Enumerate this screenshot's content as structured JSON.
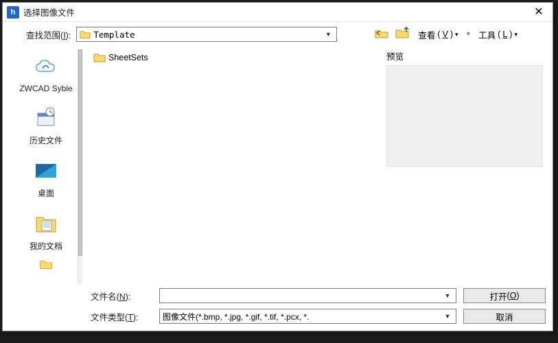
{
  "window": {
    "title": "选择图像文件"
  },
  "toolbar": {
    "lookin_label": "查找范围",
    "lookin_mnemonic": "I",
    "lookin_value": "Template",
    "view_label": "查看",
    "view_mnemonic": "V",
    "tools_label": "工具",
    "tools_mnemonic": "L"
  },
  "sidebar": {
    "items": [
      {
        "label": "ZWCAD Syble"
      },
      {
        "label": "历史文件"
      },
      {
        "label": "桌面"
      },
      {
        "label": "我的文档"
      }
    ]
  },
  "files": {
    "items": [
      {
        "name": "SheetSets",
        "type": "folder"
      }
    ]
  },
  "preview": {
    "label": "预览"
  },
  "bottom": {
    "filename_label": "文件名",
    "filename_mnemonic": "N",
    "filename_value": "",
    "filetype_label": "文件类型",
    "filetype_mnemonic": "T",
    "filetype_value": "图像文件(*.bmp, *.jpg, *.gif, *.tif, *.pcx, *.",
    "open_label": "打开",
    "open_mnemonic": "O",
    "cancel_label": "取消"
  }
}
